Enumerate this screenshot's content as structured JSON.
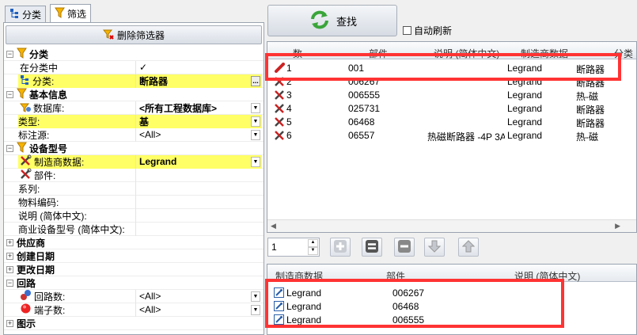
{
  "tabs": [
    {
      "label": "分类",
      "icon": "tree-icon"
    },
    {
      "label": "筛选",
      "icon": "funnel-icon"
    }
  ],
  "left": {
    "delete_filter": "删除筛选器",
    "rows": [
      {
        "type": "cat",
        "label": "分类",
        "toggle": "−"
      },
      {
        "type": "row",
        "label": "在分类中",
        "value": "✓",
        "kind": "checkbox"
      },
      {
        "type": "row",
        "label": "分类:",
        "value": "断路器",
        "yellow": true,
        "bold": true,
        "icon": "tree-icon",
        "ellipsis": true
      },
      {
        "type": "cat",
        "label": "基本信息",
        "toggle": "−"
      },
      {
        "type": "row",
        "label": "数据库:",
        "value": "<所有工程数据库>",
        "bold": true,
        "icon": "database-icon",
        "dropdown": true
      },
      {
        "type": "row",
        "label": "类型:",
        "value": "基",
        "yellow": true,
        "bold": true,
        "dropdown": true,
        "noindent": true
      },
      {
        "type": "row",
        "label": "标注源:",
        "value": "<All>",
        "dropdown": true,
        "noindent": true
      },
      {
        "type": "cat",
        "label": "设备型号",
        "toggle": "−"
      },
      {
        "type": "row",
        "label": "制造商数据:",
        "value": "Legrand",
        "yellow": true,
        "bold": true,
        "icon": "tools-icon",
        "dropdown": true
      },
      {
        "type": "row",
        "label": "部件:",
        "value": "",
        "icon": "tools-icon"
      },
      {
        "type": "row",
        "label": "系列:",
        "value": "",
        "noindent": true
      },
      {
        "type": "row",
        "label": "物料编码:",
        "value": "",
        "noindent": true
      },
      {
        "type": "row",
        "label": "说明 (简体中文):",
        "value": "",
        "noindent": true
      },
      {
        "type": "row",
        "label": "商业设备型号 (简体中文):",
        "value": "",
        "noindent": true
      },
      {
        "type": "cat",
        "label": "供应商",
        "toggle": "+"
      },
      {
        "type": "cat",
        "label": "创建日期",
        "toggle": "+"
      },
      {
        "type": "cat",
        "label": "更改日期",
        "toggle": "+"
      },
      {
        "type": "cat",
        "label": "回路",
        "toggle": "−"
      },
      {
        "type": "row",
        "label": "回路数:",
        "value": "<All>",
        "icon": "circuit-icon",
        "dropdown": true
      },
      {
        "type": "row",
        "label": "端子数:",
        "value": "<All>",
        "icon": "terminal-icon",
        "dropdown": true
      },
      {
        "type": "cat",
        "label": "图示",
        "toggle": "+"
      }
    ]
  },
  "toolbar": {
    "search": "查找",
    "autorefresh": "自动刷新"
  },
  "top_grid": {
    "headers": [
      "数",
      "部件",
      "说明 (简体中文)",
      "制造商数据",
      "分类"
    ],
    "rows": [
      {
        "n": "1",
        "part": "001",
        "desc": "",
        "mfr": "Legrand",
        "cat": "断路器",
        "selected": true
      },
      {
        "n": "2",
        "part": "006267",
        "desc": "",
        "mfr": "Legrand",
        "cat": "断路器"
      },
      {
        "n": "3",
        "part": "006555",
        "desc": "",
        "mfr": "Legrand",
        "cat": "热-磁"
      },
      {
        "n": "4",
        "part": "025731",
        "desc": "",
        "mfr": "Legrand",
        "cat": "断路器"
      },
      {
        "n": "5",
        "part": "06468",
        "desc": "",
        "mfr": "Legrand",
        "cat": "断路器"
      },
      {
        "n": "6",
        "part": "06557",
        "desc": "热磁断路器 -4P 3A",
        "mfr": "Legrand",
        "cat": "热-磁"
      }
    ]
  },
  "pager": {
    "value": "1"
  },
  "bottom_grid": {
    "headers": [
      "制造商数据",
      "部件",
      "说明 (简体中文)"
    ],
    "rows": [
      {
        "mfr": "Legrand",
        "part": "006267"
      },
      {
        "mfr": "Legrand",
        "part": "06468"
      },
      {
        "mfr": "Legrand",
        "part": "006555"
      }
    ]
  },
  "colors": {
    "highlight": "#ffff66",
    "annotation": "#ff3333",
    "accent": "#f0a000"
  }
}
